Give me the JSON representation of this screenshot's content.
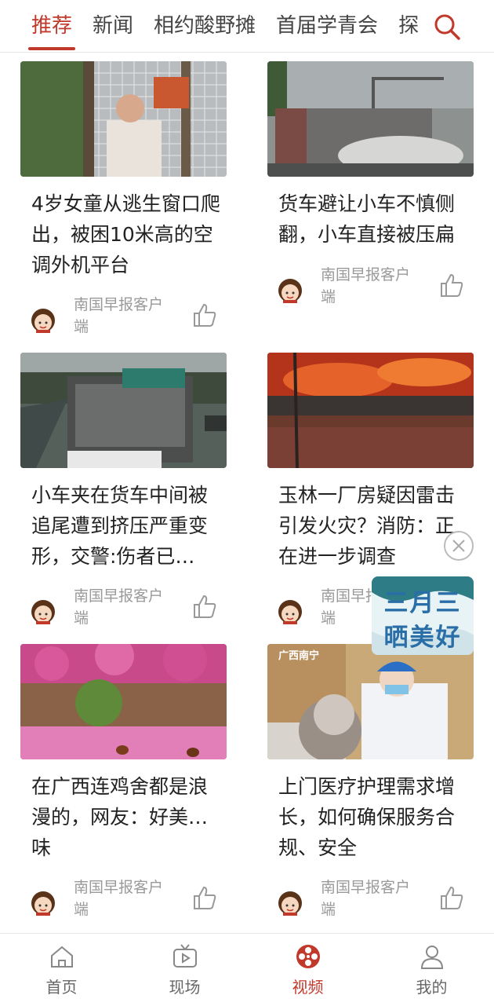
{
  "tabs": [
    "推荐",
    "新闻",
    "相约酸野摊",
    "首届学青会",
    "探"
  ],
  "active_tab": "推荐",
  "cards": [
    {
      "title": "4岁女童从逃生窗口爬出，被困10米高的空调外机平台",
      "source": "南国早报客户端"
    },
    {
      "title": "货车避让小车不慎侧翻，小车直接被压扁",
      "source": "南国早报客户端"
    },
    {
      "title": "小车夹在货车中间被追尾遭到挤压严重变形，交警:伤者已…",
      "source": "南国早报客户端"
    },
    {
      "title": "玉林一厂房疑因雷击引发火灾？消防：正在进一步调查",
      "source": "南国早报客户端"
    },
    {
      "title": "在广西连鸡舍都是浪漫的，网友：好美…味",
      "source": "南国早报客户端"
    },
    {
      "title": "上门医疗护理需求增长，如何确保服务合规、安全",
      "source": "南国早报客户端"
    }
  ],
  "promo": {
    "line1": "三月三",
    "line2": "晒美好"
  },
  "overlay_text": {
    "location": "广西南宁"
  },
  "nav": [
    {
      "label": "首页",
      "icon": "home-icon"
    },
    {
      "label": "现场",
      "icon": "tv-icon"
    },
    {
      "label": "视频",
      "icon": "film-reel-icon"
    },
    {
      "label": "我的",
      "icon": "user-icon"
    }
  ],
  "active_nav": "视频",
  "colors": {
    "accent": "#c0392b",
    "muted": "#9a9a9a",
    "text": "#222222"
  }
}
